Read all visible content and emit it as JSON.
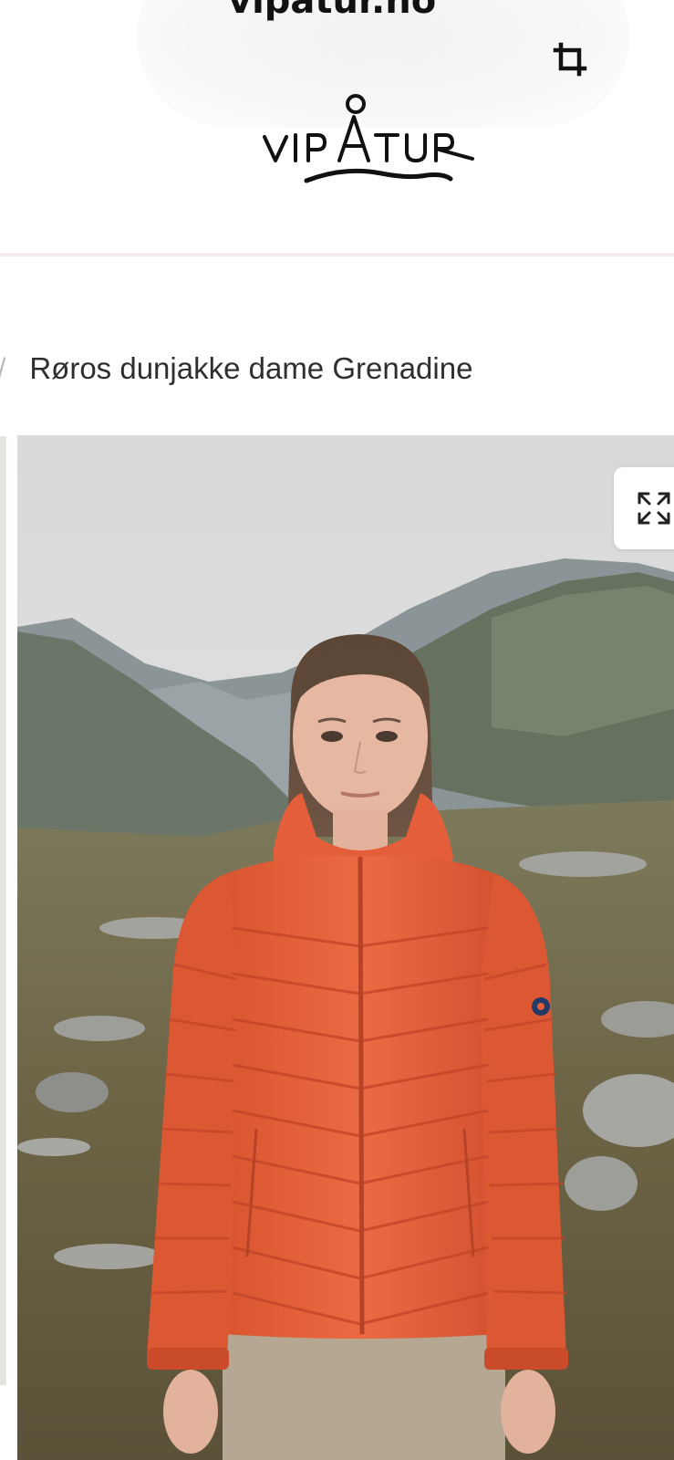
{
  "browser": {
    "domain": "vipatur.no"
  },
  "header": {
    "logo_text": "VIPÅTUR",
    "crop_icon": "crop-icon"
  },
  "breadcrumb": {
    "separator": "/",
    "current": "Røros dunjakke dame Grenadine"
  },
  "gallery": {
    "expand_icon": "expand-icon",
    "image_alt": "Woman wearing an orange quilted down jacket with hood in a mountain valley",
    "colors": {
      "jacket": "#e8663f",
      "sky": "#dcdddc",
      "mountain": "#6f7a6c"
    }
  }
}
